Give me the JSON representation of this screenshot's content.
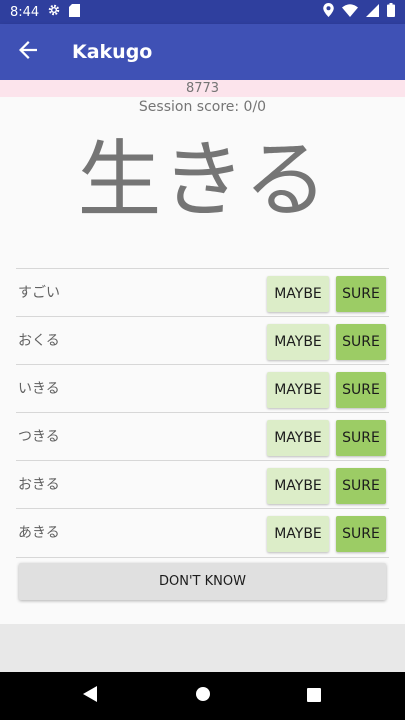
{
  "status": {
    "time": "8:44"
  },
  "appbar": {
    "title": "Kakugo"
  },
  "quiz": {
    "count": "8773",
    "session_score": "Session score: 0/0",
    "question": "生きる",
    "options": [
      {
        "label": "すごい",
        "maybe": "MAYBE",
        "sure": "SURE"
      },
      {
        "label": "おくる",
        "maybe": "MAYBE",
        "sure": "SURE"
      },
      {
        "label": "いきる",
        "maybe": "MAYBE",
        "sure": "SURE"
      },
      {
        "label": "つきる",
        "maybe": "MAYBE",
        "sure": "SURE"
      },
      {
        "label": "おきる",
        "maybe": "MAYBE",
        "sure": "SURE"
      },
      {
        "label": "あきる",
        "maybe": "MAYBE",
        "sure": "SURE"
      }
    ],
    "dont_know": "DON'T KNOW"
  },
  "icons": {
    "status_left": [
      "gear-icon",
      "sd-card-icon"
    ],
    "status_right": [
      "location-icon",
      "wifi-icon",
      "signal-icon",
      "battery-icon"
    ],
    "appbar": [
      "back-arrow-icon"
    ],
    "navbar": [
      "nav-back-icon",
      "nav-home-icon",
      "nav-recents-icon"
    ]
  },
  "colors": {
    "statusbar": "#2f3f9e",
    "appbar": "#3f51b5",
    "maybe": "#dcedc8",
    "sure": "#9ccc65",
    "progress": "#fce4ec"
  }
}
